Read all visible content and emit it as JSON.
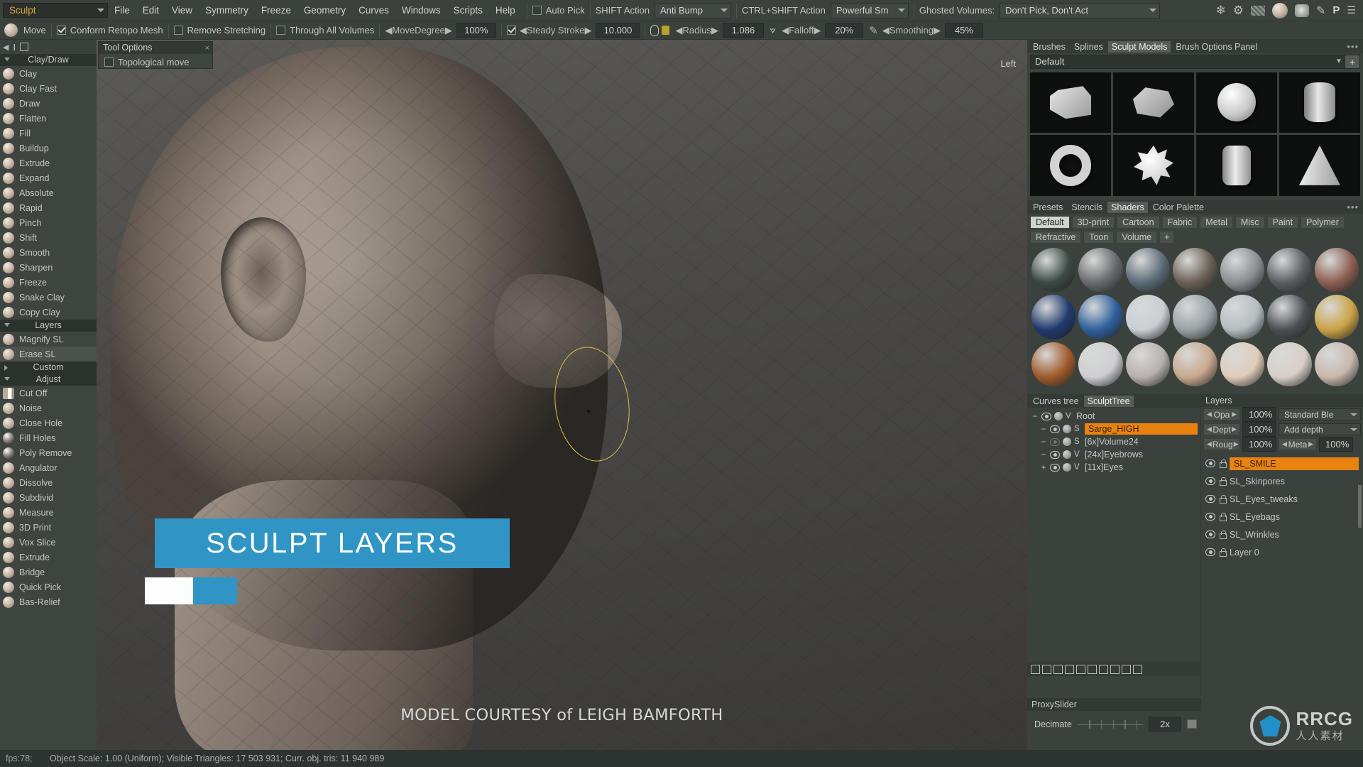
{
  "app": {
    "mode": "Sculpt",
    "menus": [
      "File",
      "Edit",
      "View",
      "Symmetry",
      "Freeze",
      "Geometry",
      "Curves",
      "Windows",
      "Scripts",
      "Help"
    ],
    "auto_pick_label": "Auto Pick",
    "shift_action_label": "SHIFT Action",
    "shift_action_value": "Anti Bump",
    "ctrl_shift_action_label": "CTRL+SHIFT Action",
    "ctrl_shift_action_value": "Powerful Sm",
    "ghosted_label": "Ghosted Volumes:",
    "ghosted_value": "Don't Pick, Don't Act"
  },
  "toolbar": {
    "tool_name": "Move",
    "conform_label": "Conform Retopo Mesh",
    "remove_label": "Remove Stretching",
    "through_label": "Through All Volumes",
    "move_degree_label": "MoveDegree",
    "move_degree_value": "100%",
    "steady_stroke_label": "Steady Stroke",
    "steady_stroke_value": "10.000",
    "radius_label": "Radius",
    "radius_value": "1.086",
    "falloff_label": "Falloff",
    "falloff_value": "20%",
    "smoothing_label": "Smoothing",
    "smoothing_value": "45%"
  },
  "tool_options": {
    "title": "Tool Options",
    "topological_move": "Topological move",
    "close": "×"
  },
  "left_tools": {
    "groups": [
      {
        "title": "Clay/Draw",
        "collapsed": false,
        "items": [
          "Clay",
          "Clay Fast",
          "Draw",
          "Flatten",
          "Fill",
          "Buildup",
          "Extrude",
          "Expand",
          "Absolute",
          "Rapid",
          "Pinch",
          "Shift",
          "Smooth",
          "Sharpen",
          "Freeze",
          "Snake Clay",
          "Copy Clay"
        ]
      },
      {
        "title": "Layers",
        "collapsed": false,
        "items": [
          "Magnify SL",
          "Erase SL"
        ]
      },
      {
        "title": "Custom",
        "collapsed": true,
        "items": []
      },
      {
        "title": "Adjust",
        "collapsed": false,
        "items": [
          "Cut Off",
          "Noise",
          "Close Hole",
          "Fill Holes",
          "Poly Remove",
          "Angulator",
          "Dissolve",
          "Subdivid",
          "Measure",
          "3D Print",
          "Vox Slice",
          "Extrude",
          "Bridge",
          "Quick Pick",
          "Bas-Relief"
        ]
      }
    ],
    "selected": "Erase SL"
  },
  "viewport": {
    "view_label": "Left",
    "courtesy": "MODEL COURTESY of LEIGH BAMFORTH",
    "banner_text": "SCULPT LAYERS"
  },
  "status": {
    "fps": "fps:78;",
    "text": "Object Scale: 1.00 (Uniform); Visible Triangles: 17 503 931; Curr. obj. tris: 11 940 989"
  },
  "brushes_panel": {
    "tabs": [
      "Brushes",
      "Splines",
      "Sculpt Models",
      "Brush Options Panel"
    ],
    "active_tab": "Sculpt Models",
    "preset_name": "Default",
    "add_label": "+",
    "dots": "•••",
    "cells": [
      "cube-gray",
      "cube-beveled",
      "sphere",
      "cylinder",
      "torus",
      "spike-ball",
      "rounded-cylinder",
      "cone"
    ]
  },
  "shaders_panel": {
    "tabs": [
      "Presets",
      "Stencils",
      "Shaders",
      "Color Palette"
    ],
    "active_tab": "Shaders",
    "categories": [
      "Default",
      "3D-print",
      "Cartoon",
      "Fabric",
      "Metal",
      "Misc",
      "Paint",
      "Polymer",
      "Refractive",
      "Toon",
      "Volume",
      "+"
    ],
    "active_category": "Default",
    "dots": "•••",
    "swatches": [
      "#3c4a46",
      "#6a6b6d",
      "#5d6c78",
      "#6b6057",
      "#8c8f93",
      "#5a5f63",
      "#8d5f52",
      "#203a6e",
      "#2f5f9e",
      "#c9cfd4",
      "#9aa1a6",
      "#b5bcc1",
      "#4c4f54",
      "#caa347",
      "#a05b2c",
      "#cfcfd2",
      "#b8b1ad",
      "#c8a98d",
      "#e0cdbb",
      "#d9cfc8",
      "#c7b9ae"
    ]
  },
  "sculpt_tree": {
    "tabs": [
      "Curves tree",
      "SculptTree"
    ],
    "active_tab": "SculptTree",
    "rows": [
      {
        "expander": "−",
        "visible": true,
        "kind": "V",
        "name": "Root",
        "indent": 0,
        "selected": false
      },
      {
        "expander": "−",
        "visible": true,
        "kind": "S",
        "name": "Sarge_HIGH",
        "indent": 1,
        "selected": true
      },
      {
        "expander": "−",
        "visible": false,
        "kind": "S",
        "name": "[6x]Volume24",
        "indent": 1,
        "selected": false
      },
      {
        "expander": "−",
        "visible": true,
        "kind": "V",
        "name": "[24x]Eyebrows",
        "indent": 1,
        "selected": false
      },
      {
        "expander": "+",
        "visible": true,
        "kind": "V",
        "name": "[11x]Eyes",
        "indent": 1,
        "selected": false
      }
    ]
  },
  "proxy": {
    "title": "ProxySlider",
    "decimate_label": "Decimate",
    "decimate_value": "2x"
  },
  "layers_panel": {
    "title": "Layers",
    "opacity_label": "Opa",
    "opacity_value": "100%",
    "blend_mode": "Standard Ble",
    "depth_label": "Dept",
    "depth_value": "100%",
    "depth_mode": "Add depth",
    "rough_label": "Roug",
    "rough_value": "100%",
    "metal_label": "Meta",
    "metal_value": "100%",
    "layers": [
      {
        "name": "SL_SMILE",
        "selected": true
      },
      {
        "name": "SL_Skinpores",
        "selected": false
      },
      {
        "name": "SL_Eyes_tweaks",
        "selected": false
      },
      {
        "name": "SL_Eyebags",
        "selected": false
      },
      {
        "name": "SL_Wrinkles",
        "selected": false
      },
      {
        "name": "Layer 0",
        "selected": false
      }
    ]
  },
  "watermark": {
    "title": "RRCG",
    "subtitle": "人人素材"
  },
  "colors": {
    "accent_orange": "#e8830f",
    "banner_blue": "#3095c4",
    "panel_bg": "#3b413d",
    "mode_text": "#d9a441"
  }
}
